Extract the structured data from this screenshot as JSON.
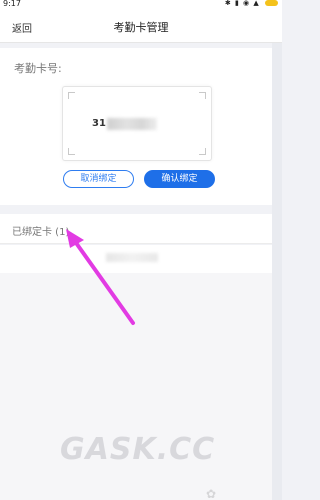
{
  "status_bar": {
    "time": "9:17",
    "icons_text": "✱ ▮ ◉ ▲"
  },
  "nav": {
    "back_label": "返回",
    "title": "考勤卡管理"
  },
  "card": {
    "label": "考勤卡号:",
    "number_visible": "31",
    "unbind_label": "取消绑定",
    "confirm_label": "确认绑定"
  },
  "bound": {
    "label": "已绑定卡 (1)"
  },
  "watermark": {
    "text": "GASK.CC"
  },
  "colors": {
    "accent": "#1e6fe8",
    "annotation_arrow": "#e23be3"
  }
}
